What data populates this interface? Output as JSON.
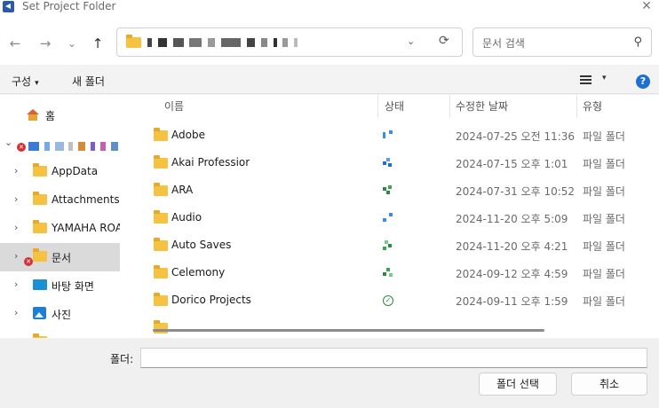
{
  "window": {
    "title": "Set Project Folder",
    "close_glyph": "✕"
  },
  "toolbar": {
    "back_glyph": "←",
    "forward_glyph": "→",
    "recent_glyph": "⌄",
    "up_glyph": "↑",
    "address_chevron": "⌄",
    "refresh_glyph": "⟳",
    "search_placeholder": "문서 검색",
    "search_glyph": "⚲"
  },
  "commandbar": {
    "organize_label": "구성",
    "organize_caret": "▾",
    "new_folder_label": "새 폴더",
    "view_caret": "▾",
    "help_glyph": "?"
  },
  "sidebar": {
    "items": [
      {
        "label": "홈",
        "icon": "home-icon"
      },
      {
        "label": "AppData",
        "icon": "folder-icon",
        "chevron": "›"
      },
      {
        "label": "Attachments",
        "icon": "folder-icon",
        "chevron": "›"
      },
      {
        "label": "YAMAHA ROA",
        "icon": "folder-icon",
        "chevron": "›"
      },
      {
        "label": "문서",
        "icon": "folder-icon",
        "chevron": "›",
        "selected": true
      },
      {
        "label": "바탕 화면",
        "icon": "desktop-icon",
        "chevron": "›"
      },
      {
        "label": "사진",
        "icon": "photos-icon",
        "chevron": "›"
      }
    ],
    "expand_chevron": "⌄",
    "error_glyph": "✕"
  },
  "columns": {
    "name": "이름",
    "status": "상태",
    "modified": "수정한 날짜",
    "type": "유형",
    "sort_glyph": "^"
  },
  "files": [
    {
      "name": "Adobe",
      "date": "2024-07-25 오전 11:36",
      "type": "파일 폴더",
      "status": "sync-blue"
    },
    {
      "name": "Akai Professior",
      "date": "2024-07-15 오후 1:01",
      "type": "파일 폴더",
      "status": "sync-blue2"
    },
    {
      "name": "ARA",
      "date": "2024-07-31 오후 10:52",
      "type": "파일 폴더",
      "status": "sync-green"
    },
    {
      "name": "Audio",
      "date": "2024-11-20 오후 5:09",
      "type": "파일 폴더",
      "status": "sync-blue"
    },
    {
      "name": "Auto Saves",
      "date": "2024-11-20 오후 4:21",
      "type": "파일 폴더",
      "status": "sync-green2"
    },
    {
      "name": "Celemony",
      "date": "2024-09-12 오후 4:59",
      "type": "파일 폴더",
      "status": "sync-green3"
    },
    {
      "name": "Dorico Projects",
      "date": "2024-09-11 오후 1:59",
      "type": "파일 폴더",
      "status": "available-check"
    }
  ],
  "status_check_glyph": "✓",
  "footer": {
    "folder_label": "폴더:",
    "folder_value": "",
    "select_button": "폴더 선택",
    "cancel_button": "취소"
  },
  "colors": {
    "accent": "#1e6fd0",
    "folder": "#f5c242",
    "selection": "#dadada"
  }
}
